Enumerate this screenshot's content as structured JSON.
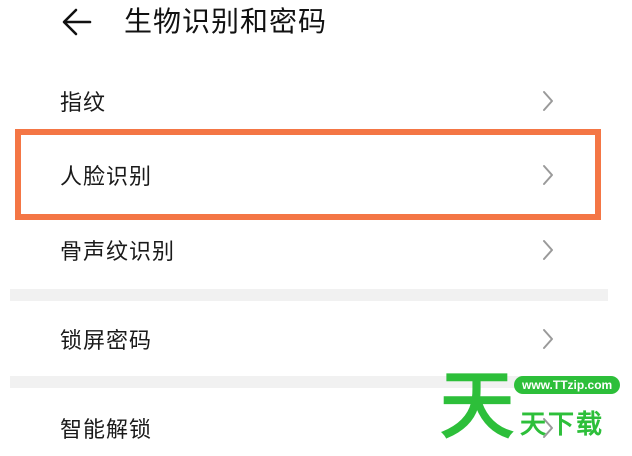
{
  "header": {
    "title": "生物识别和密码"
  },
  "settings": {
    "fingerprint": "指纹",
    "face_recognition": "人脸识别",
    "voiceprint_recognition": "骨声纹识别",
    "lock_screen_password": "锁屏密码",
    "smart_unlock": "智能解锁"
  },
  "watermark": {
    "big_char": "天",
    "url": "www.TTzip.com",
    "text": "天下载"
  },
  "colors": {
    "highlight": "#f47645",
    "watermark": "#2dbf3a"
  }
}
